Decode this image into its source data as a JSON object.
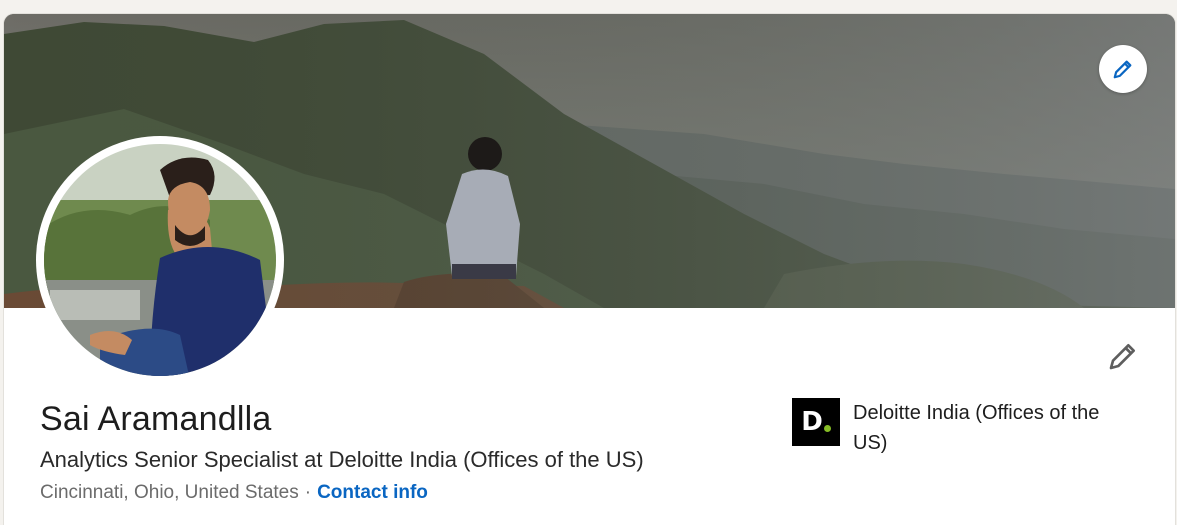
{
  "profile": {
    "name": "Sai Aramandlla",
    "headline": "Analytics Senior Specialist at Deloitte India (Offices of the US)",
    "location": "Cincinnati, Ohio, United States",
    "separator": "·",
    "contact_info_label": "Contact info"
  },
  "experience": {
    "company_name": "Deloitte India (Offices of the US)",
    "logo_letter": "D"
  },
  "icons": {
    "cover_edit": "pencil-icon",
    "intro_edit": "pencil-icon"
  },
  "colors": {
    "link": "#0a66c2",
    "deloitte_green": "#86bc25"
  }
}
